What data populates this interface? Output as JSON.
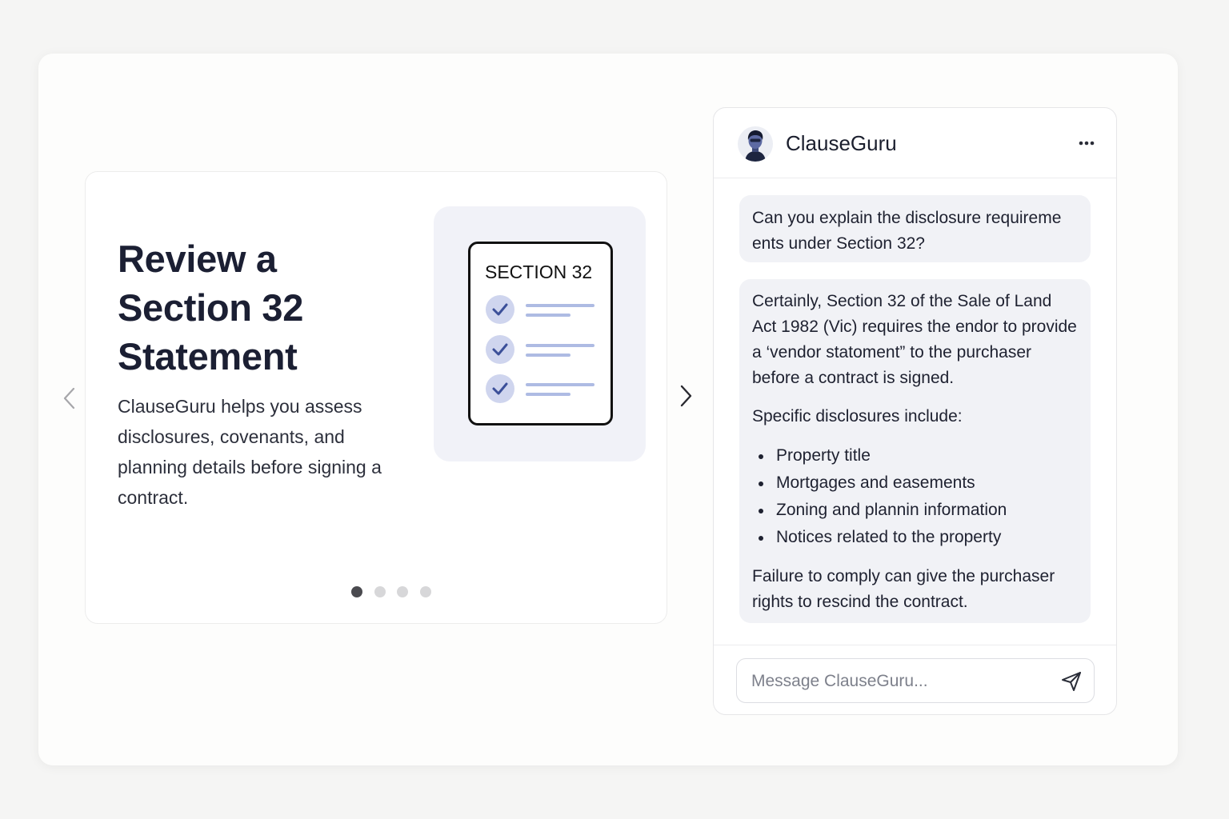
{
  "carousel": {
    "title_lines": [
      "Review a",
      "Section 32",
      "Statement"
    ],
    "description": "ClauseGuru helps you assess disclosures, covenants, and planning details before signing a contract.",
    "illustration": {
      "doc_title": "SECTION 32",
      "checklist_items": 3,
      "icon": "checkmark-icon"
    },
    "slide_count": 4,
    "active_slide": 1,
    "prev_icon": "chevron-left-icon",
    "next_icon": "chevron-right-icon"
  },
  "chat": {
    "bot_name": "ClauseGuru",
    "menu_icon": "more-horizontal-icon",
    "avatar_icon": "bot-avatar-icon",
    "messages": [
      {
        "role": "user",
        "text": "Can you explain the disclosure requireme ents under Section 32?"
      },
      {
        "role": "assistant",
        "intro": "Certainly, Section 32 of the Sale of Land Act 1982 (Vic) requires the endor to provide a ‘vendor statoment” to the purchaser before a contract is signed.",
        "list_heading": "Specific disclosures include:",
        "items": [
          "Property title",
          "Mortgages and easements",
          "Zoning and plannin information",
          "Notices related to the property"
        ],
        "closing": "Failure to comply can give the purchaser rights to rescind the contract."
      }
    ],
    "composer": {
      "placeholder": "Message ClauseGuru...",
      "value": "",
      "send_icon": "send-icon"
    }
  },
  "colors": {
    "page_background": "#f5f5f4",
    "card_background": "#fdfdfc",
    "bubble_background": "#f1f2f6",
    "illustration_panel": "#f1f2f8",
    "check_circle": "#cfd5ee",
    "check_accent": "#3b4f99",
    "line_accent": "#aebbe3",
    "dot_active": "#4a4a4f",
    "dot_inactive": "#d7d7d9",
    "title_text": "#1b1f33"
  }
}
